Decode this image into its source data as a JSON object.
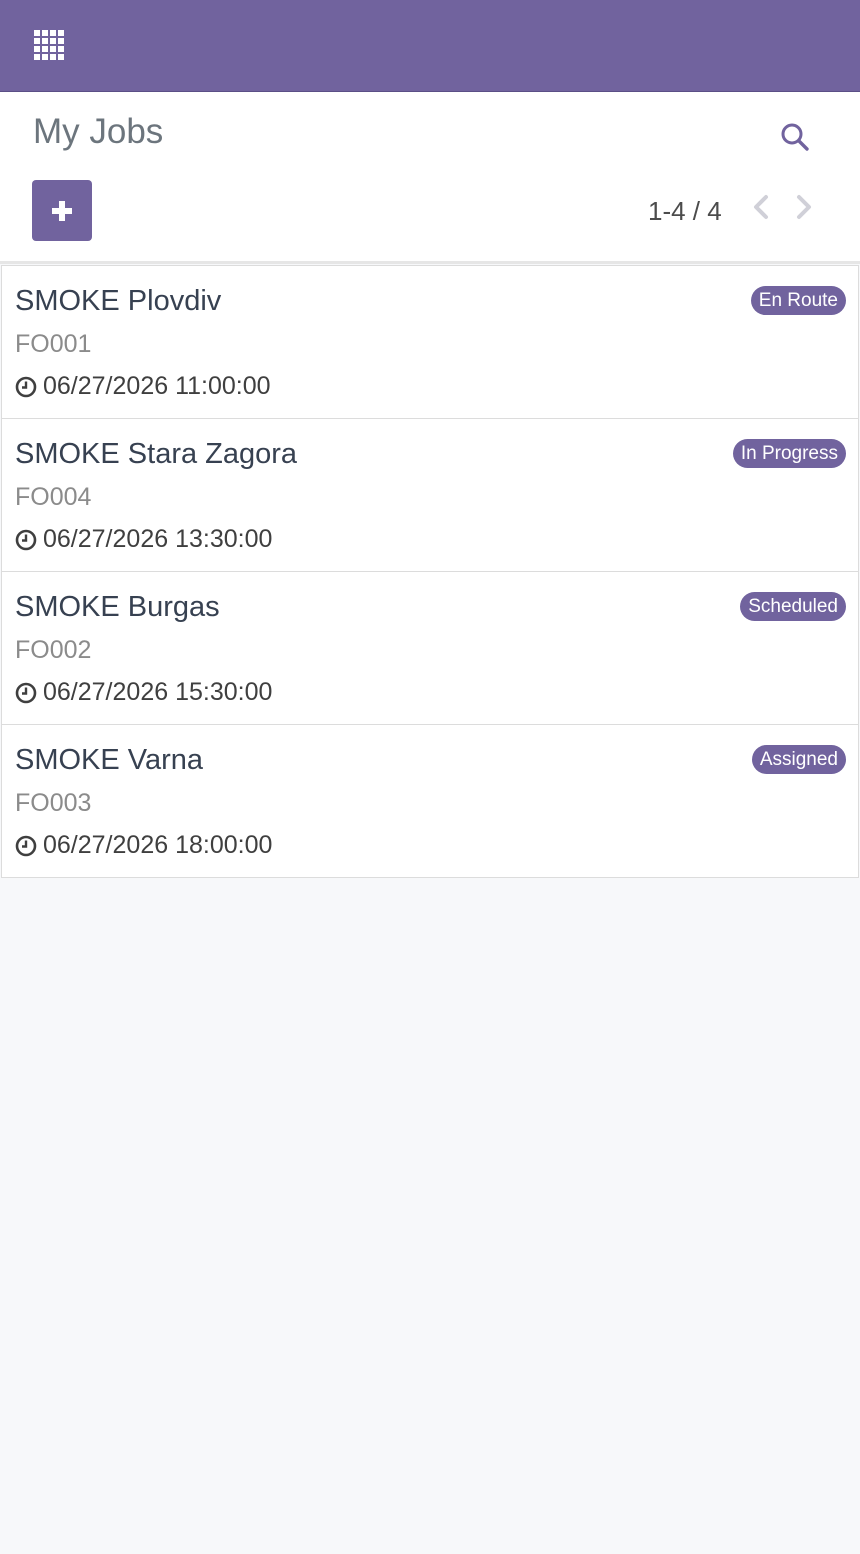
{
  "navbar": {
    "apps_icon": "apps-grid-icon",
    "color": "#71639e"
  },
  "control_panel": {
    "title": "My Jobs",
    "search_icon": "search-icon",
    "create_icon": "plus-icon",
    "pager": {
      "value": "1-4 / 4",
      "prev_icon": "chevron-left-icon",
      "next_icon": "chevron-right-icon"
    }
  },
  "jobs": [
    {
      "name": "SMOKE Plovdiv",
      "ref": "FO001",
      "date": "06/27/2026 11:00:00",
      "status": "En Route"
    },
    {
      "name": "SMOKE Stara Zagora",
      "ref": "FO004",
      "date": "06/27/2026 13:30:00",
      "status": "In Progress"
    },
    {
      "name": "SMOKE Burgas",
      "ref": "FO002",
      "date": "06/27/2026 15:30:00",
      "status": "Scheduled"
    },
    {
      "name": "SMOKE Varna",
      "ref": "FO003",
      "date": "06/27/2026 18:00:00",
      "status": "Assigned"
    }
  ],
  "colors": {
    "accent": "#71639e",
    "background": "#f7f8fa",
    "card": "#ffffff"
  }
}
